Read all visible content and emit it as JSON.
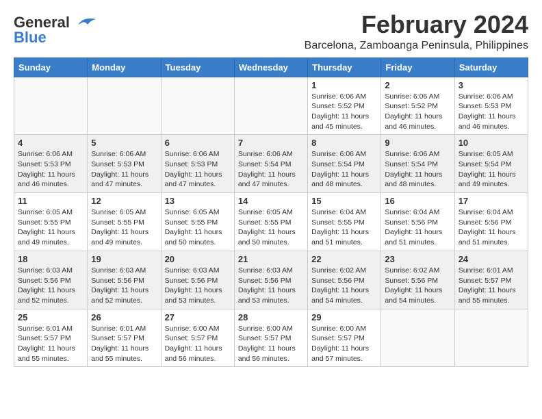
{
  "header": {
    "logo_general": "General",
    "logo_blue": "Blue",
    "month_title": "February 2024",
    "location": "Barcelona, Zamboanga Peninsula, Philippines"
  },
  "weekdays": [
    "Sunday",
    "Monday",
    "Tuesday",
    "Wednesday",
    "Thursday",
    "Friday",
    "Saturday"
  ],
  "weeks": [
    [
      {
        "day": "",
        "info": ""
      },
      {
        "day": "",
        "info": ""
      },
      {
        "day": "",
        "info": ""
      },
      {
        "day": "",
        "info": ""
      },
      {
        "day": "1",
        "info": "Sunrise: 6:06 AM\nSunset: 5:52 PM\nDaylight: 11 hours\nand 45 minutes."
      },
      {
        "day": "2",
        "info": "Sunrise: 6:06 AM\nSunset: 5:52 PM\nDaylight: 11 hours\nand 46 minutes."
      },
      {
        "day": "3",
        "info": "Sunrise: 6:06 AM\nSunset: 5:53 PM\nDaylight: 11 hours\nand 46 minutes."
      }
    ],
    [
      {
        "day": "4",
        "info": "Sunrise: 6:06 AM\nSunset: 5:53 PM\nDaylight: 11 hours\nand 46 minutes."
      },
      {
        "day": "5",
        "info": "Sunrise: 6:06 AM\nSunset: 5:53 PM\nDaylight: 11 hours\nand 47 minutes."
      },
      {
        "day": "6",
        "info": "Sunrise: 6:06 AM\nSunset: 5:53 PM\nDaylight: 11 hours\nand 47 minutes."
      },
      {
        "day": "7",
        "info": "Sunrise: 6:06 AM\nSunset: 5:54 PM\nDaylight: 11 hours\nand 47 minutes."
      },
      {
        "day": "8",
        "info": "Sunrise: 6:06 AM\nSunset: 5:54 PM\nDaylight: 11 hours\nand 48 minutes."
      },
      {
        "day": "9",
        "info": "Sunrise: 6:06 AM\nSunset: 5:54 PM\nDaylight: 11 hours\nand 48 minutes."
      },
      {
        "day": "10",
        "info": "Sunrise: 6:05 AM\nSunset: 5:54 PM\nDaylight: 11 hours\nand 49 minutes."
      }
    ],
    [
      {
        "day": "11",
        "info": "Sunrise: 6:05 AM\nSunset: 5:55 PM\nDaylight: 11 hours\nand 49 minutes."
      },
      {
        "day": "12",
        "info": "Sunrise: 6:05 AM\nSunset: 5:55 PM\nDaylight: 11 hours\nand 49 minutes."
      },
      {
        "day": "13",
        "info": "Sunrise: 6:05 AM\nSunset: 5:55 PM\nDaylight: 11 hours\nand 50 minutes."
      },
      {
        "day": "14",
        "info": "Sunrise: 6:05 AM\nSunset: 5:55 PM\nDaylight: 11 hours\nand 50 minutes."
      },
      {
        "day": "15",
        "info": "Sunrise: 6:04 AM\nSunset: 5:55 PM\nDaylight: 11 hours\nand 51 minutes."
      },
      {
        "day": "16",
        "info": "Sunrise: 6:04 AM\nSunset: 5:56 PM\nDaylight: 11 hours\nand 51 minutes."
      },
      {
        "day": "17",
        "info": "Sunrise: 6:04 AM\nSunset: 5:56 PM\nDaylight: 11 hours\nand 51 minutes."
      }
    ],
    [
      {
        "day": "18",
        "info": "Sunrise: 6:03 AM\nSunset: 5:56 PM\nDaylight: 11 hours\nand 52 minutes."
      },
      {
        "day": "19",
        "info": "Sunrise: 6:03 AM\nSunset: 5:56 PM\nDaylight: 11 hours\nand 52 minutes."
      },
      {
        "day": "20",
        "info": "Sunrise: 6:03 AM\nSunset: 5:56 PM\nDaylight: 11 hours\nand 53 minutes."
      },
      {
        "day": "21",
        "info": "Sunrise: 6:03 AM\nSunset: 5:56 PM\nDaylight: 11 hours\nand 53 minutes."
      },
      {
        "day": "22",
        "info": "Sunrise: 6:02 AM\nSunset: 5:56 PM\nDaylight: 11 hours\nand 54 minutes."
      },
      {
        "day": "23",
        "info": "Sunrise: 6:02 AM\nSunset: 5:56 PM\nDaylight: 11 hours\nand 54 minutes."
      },
      {
        "day": "24",
        "info": "Sunrise: 6:01 AM\nSunset: 5:57 PM\nDaylight: 11 hours\nand 55 minutes."
      }
    ],
    [
      {
        "day": "25",
        "info": "Sunrise: 6:01 AM\nSunset: 5:57 PM\nDaylight: 11 hours\nand 55 minutes."
      },
      {
        "day": "26",
        "info": "Sunrise: 6:01 AM\nSunset: 5:57 PM\nDaylight: 11 hours\nand 55 minutes."
      },
      {
        "day": "27",
        "info": "Sunrise: 6:00 AM\nSunset: 5:57 PM\nDaylight: 11 hours\nand 56 minutes."
      },
      {
        "day": "28",
        "info": "Sunrise: 6:00 AM\nSunset: 5:57 PM\nDaylight: 11 hours\nand 56 minutes."
      },
      {
        "day": "29",
        "info": "Sunrise: 6:00 AM\nSunset: 5:57 PM\nDaylight: 11 hours\nand 57 minutes."
      },
      {
        "day": "",
        "info": ""
      },
      {
        "day": "",
        "info": ""
      }
    ]
  ]
}
